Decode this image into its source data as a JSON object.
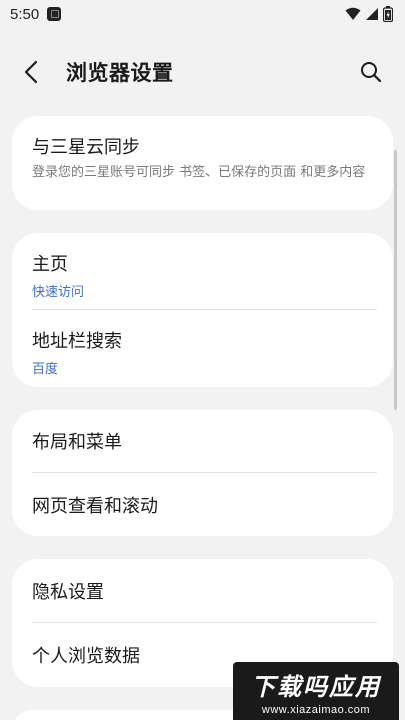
{
  "status_bar": {
    "time": "5:50"
  },
  "header": {
    "title": "浏览器设置"
  },
  "sync": {
    "title": "与三星云同步",
    "subtitle": "登录您的三星账号可同步 书签、已保存的页面 和更多内容"
  },
  "homepage": {
    "title": "主页",
    "value": "快速访问"
  },
  "address_bar_search": {
    "title": "地址栏搜索",
    "value": "百度"
  },
  "layout_menu": {
    "title": "布局和菜单"
  },
  "page_view_scroll": {
    "title": "网页查看和滚动"
  },
  "privacy_settings": {
    "title": "隐私设置"
  },
  "personal_data": {
    "title": "个人浏览数据"
  },
  "watermark": {
    "title": "下载吗应用",
    "url": "www.xiazaimao.com"
  },
  "colors": {
    "background": "#f2f2f2",
    "card": "#ffffff",
    "accent_link": "#3e6fc9"
  }
}
